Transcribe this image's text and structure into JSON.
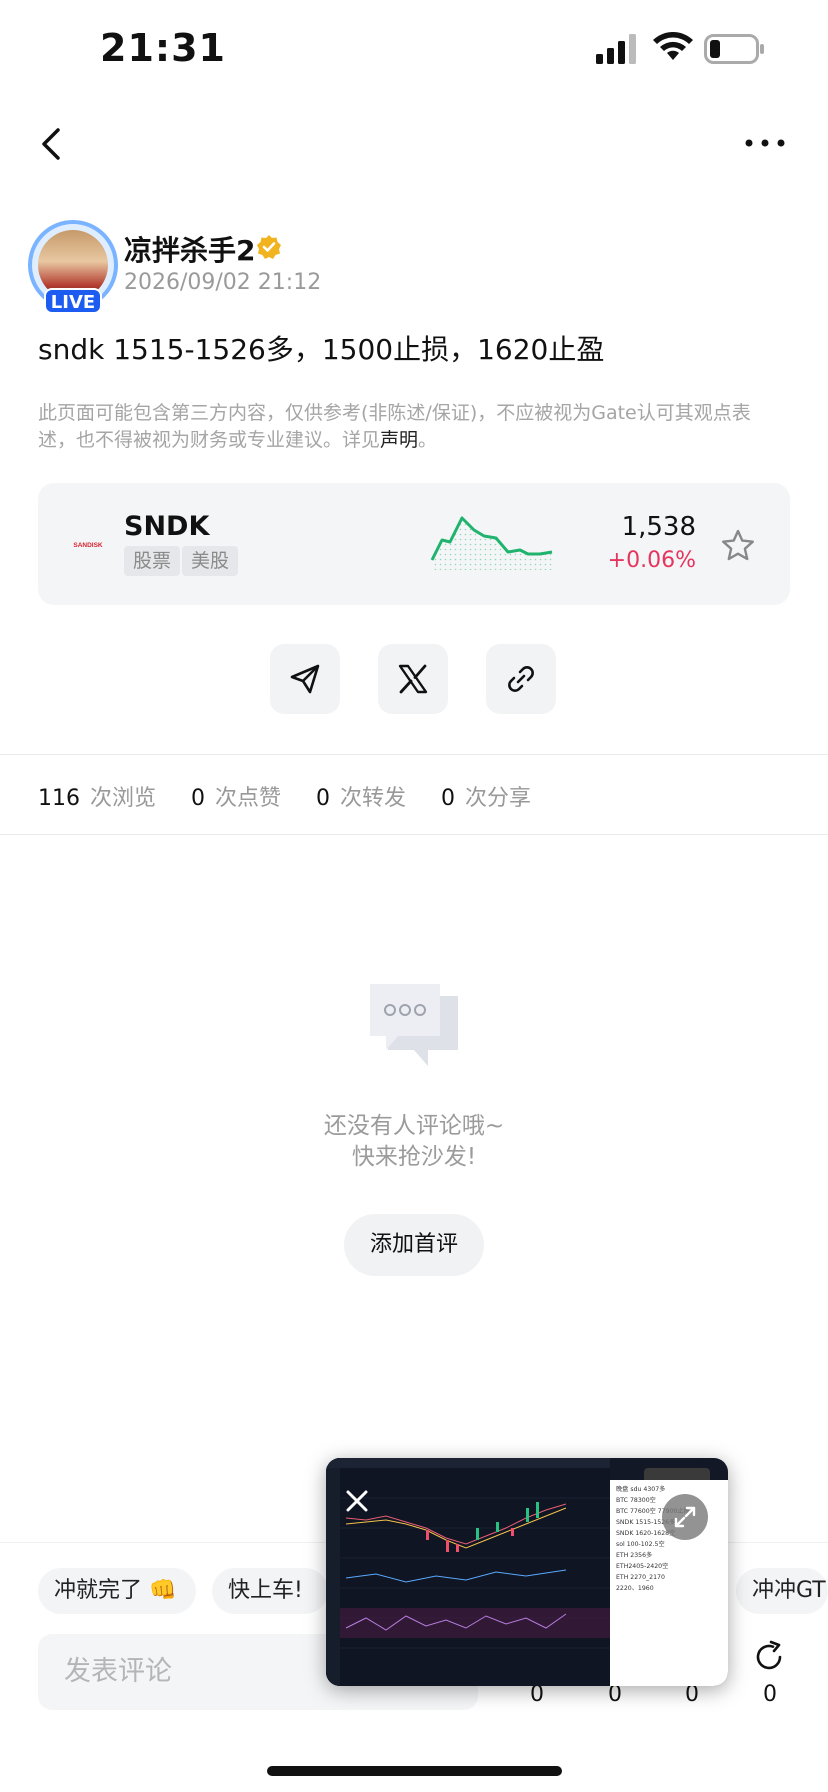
{
  "status_bar": {
    "time": "21:31"
  },
  "author": {
    "name": "凉拌杀手2",
    "live_label": "LIVE",
    "post_time": "2026/09/02 21:12"
  },
  "post": {
    "text": "sndk 1515-1526多，1500止损，1620止盈"
  },
  "disclaimer": {
    "text": "此页面可能包含第三方内容，仅供参考(非陈述/保证)，不应被视为Gate认可其观点表述，也不得被视为财务或专业建议。详见",
    "link": "声明",
    "end": "。"
  },
  "stock_card": {
    "logo_text": "SANDISK",
    "ticker": "SNDK",
    "tags": [
      "股票",
      "美股"
    ],
    "price": "1,538",
    "change": "+0.06%",
    "trend_color": "#1fb36e",
    "change_color": "#e5355f"
  },
  "stats": [
    {
      "num": "116",
      "label": "次浏览"
    },
    {
      "num": "0",
      "label": "次点赞"
    },
    {
      "num": "0",
      "label": "次转发"
    },
    {
      "num": "0",
      "label": "次分享"
    }
  ],
  "empty_state": {
    "line1": "还没有人评论哦~",
    "line2": "快来抢沙发!",
    "button": "添加首评"
  },
  "quick_replies": [
    "冲就完了 👊",
    "快上车!",
    "冲冲GT"
  ],
  "comment_input": {
    "placeholder": "发表评论"
  },
  "counters": [
    "0",
    "0",
    "0",
    "0"
  ],
  "pip_panel": {
    "lines": [
      "晚盘 sdu 4307多",
      "BTC 78300空",
      "BTC 77600空 77900止损",
      "SNDK 1515-1526多",
      "SNDK 1620-1628空",
      "sol 100-102.5空",
      "ETH 2356多",
      "ETH2405-2420空",
      "ETH 2270_2170",
      "2220、1960"
    ]
  },
  "icons": {
    "back": "chevron-left-icon",
    "more": "more-dots-icon",
    "verified": "verified-badge-icon",
    "star": "star-icon",
    "telegram": "telegram-icon",
    "x": "x-logo-icon",
    "link": "link-icon",
    "comment": "comment-bubble-icon",
    "refresh": "refresh-icon",
    "close": "close-icon",
    "expand": "expand-icon"
  }
}
